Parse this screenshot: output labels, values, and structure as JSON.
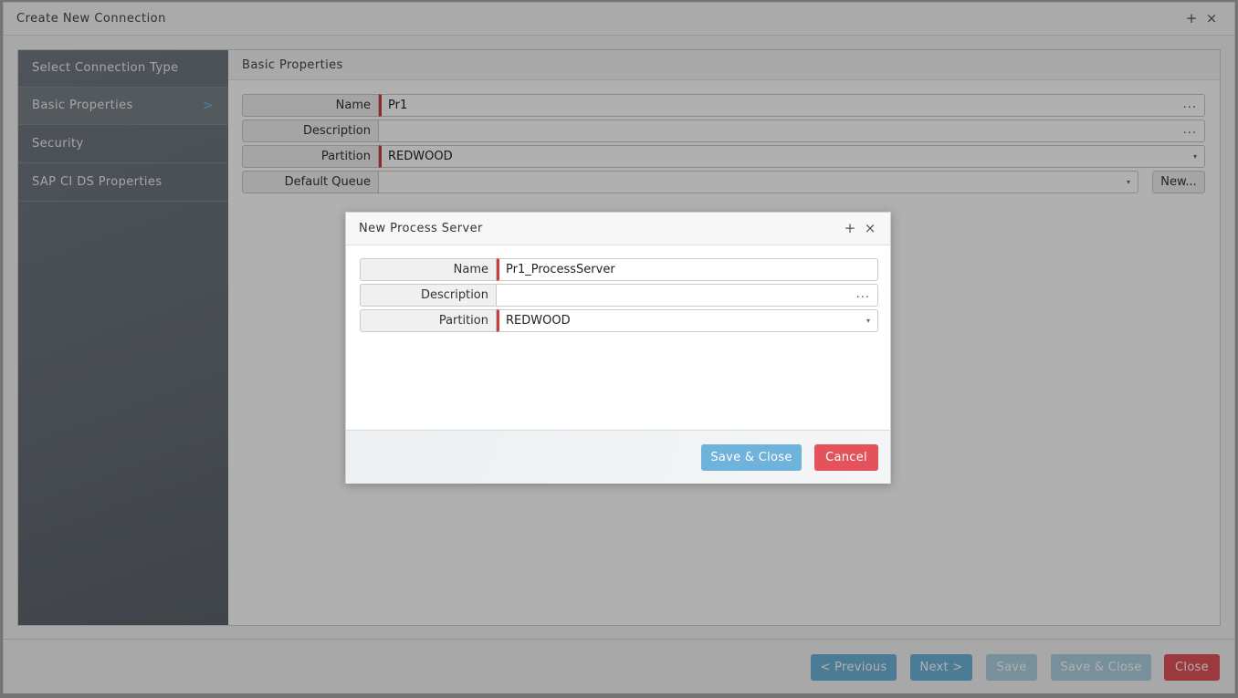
{
  "window": {
    "title": "Create New Connection",
    "controls": {
      "maximize": "+",
      "close": "×"
    }
  },
  "sidebar": {
    "items": [
      {
        "label": "Select Connection Type"
      },
      {
        "label": "Basic Properties",
        "chevron": ">"
      },
      {
        "label": "Security"
      },
      {
        "label": "SAP CI DS Properties"
      }
    ]
  },
  "content": {
    "heading": "Basic Properties",
    "fields": {
      "name": {
        "label": "Name",
        "value": "Pr1",
        "dots": "..."
      },
      "description": {
        "label": "Description",
        "value": "",
        "dots": "..."
      },
      "partition": {
        "label": "Partition",
        "value": "REDWOOD",
        "caret": "▾"
      },
      "default_queue": {
        "label": "Default Queue",
        "value": "",
        "caret": "▾",
        "new_button": "New..."
      }
    }
  },
  "footer": {
    "previous": "< Previous",
    "next": "Next >",
    "save": "Save",
    "save_close": "Save & Close",
    "close": "Close"
  },
  "dialog": {
    "title": "New Process Server",
    "controls": {
      "maximize": "+",
      "close": "×"
    },
    "fields": {
      "name": {
        "label": "Name",
        "value": "Pr1_ProcessServer"
      },
      "description": {
        "label": "Description",
        "value": "",
        "dots": "..."
      },
      "partition": {
        "label": "Partition",
        "value": "REDWOOD",
        "caret": "▾"
      }
    },
    "buttons": {
      "save_close": "Save & Close",
      "cancel": "Cancel"
    }
  },
  "colors": {
    "primary_button": "#6fb2da",
    "primary_button_dim": "#aecfe2",
    "danger_button": "#e3535c",
    "required_marker": "#cc3b3b",
    "sidebar_bg": "#6a717a"
  }
}
